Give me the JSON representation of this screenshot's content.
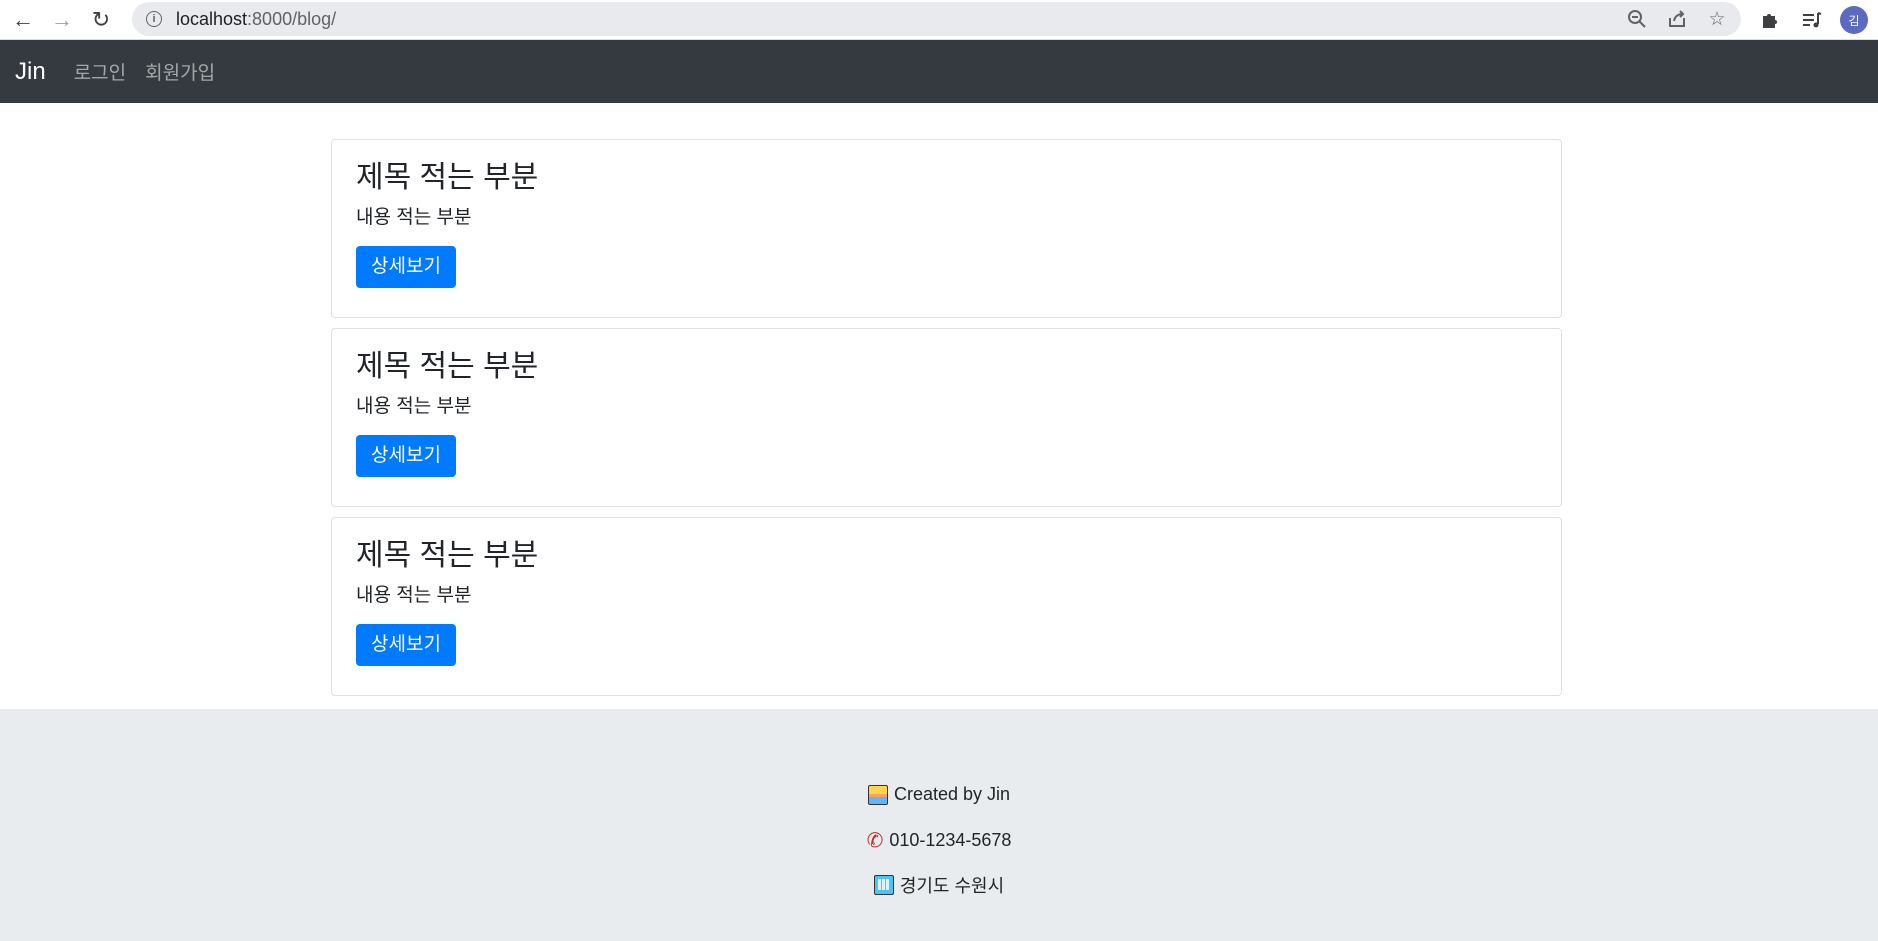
{
  "browser": {
    "url_host": "localhost",
    "url_path": ":8000/blog/",
    "avatar_text": "김"
  },
  "navbar": {
    "brand": "Jin",
    "links": [
      "로그인",
      "회원가입"
    ]
  },
  "posts": [
    {
      "title": "제목 적는 부분",
      "content": "내용 적는 부분",
      "button": "상세보기"
    },
    {
      "title": "제목 적는 부분",
      "content": "내용 적는 부분",
      "button": "상세보기"
    },
    {
      "title": "제목 적는 부분",
      "content": "내용 적는 부분",
      "button": "상세보기"
    }
  ],
  "footer": {
    "created_by": "Created by Jin",
    "phone": "010-1234-5678",
    "address": "경기도 수원시"
  },
  "colors": {
    "navbar_bg": "#343a40",
    "primary": "#007bff",
    "footer_bg": "#e9ecef"
  },
  "icons": {
    "footer_created": "sunrise-icon",
    "footer_phone": "phone-icon",
    "footer_address": "office-building-icon"
  }
}
